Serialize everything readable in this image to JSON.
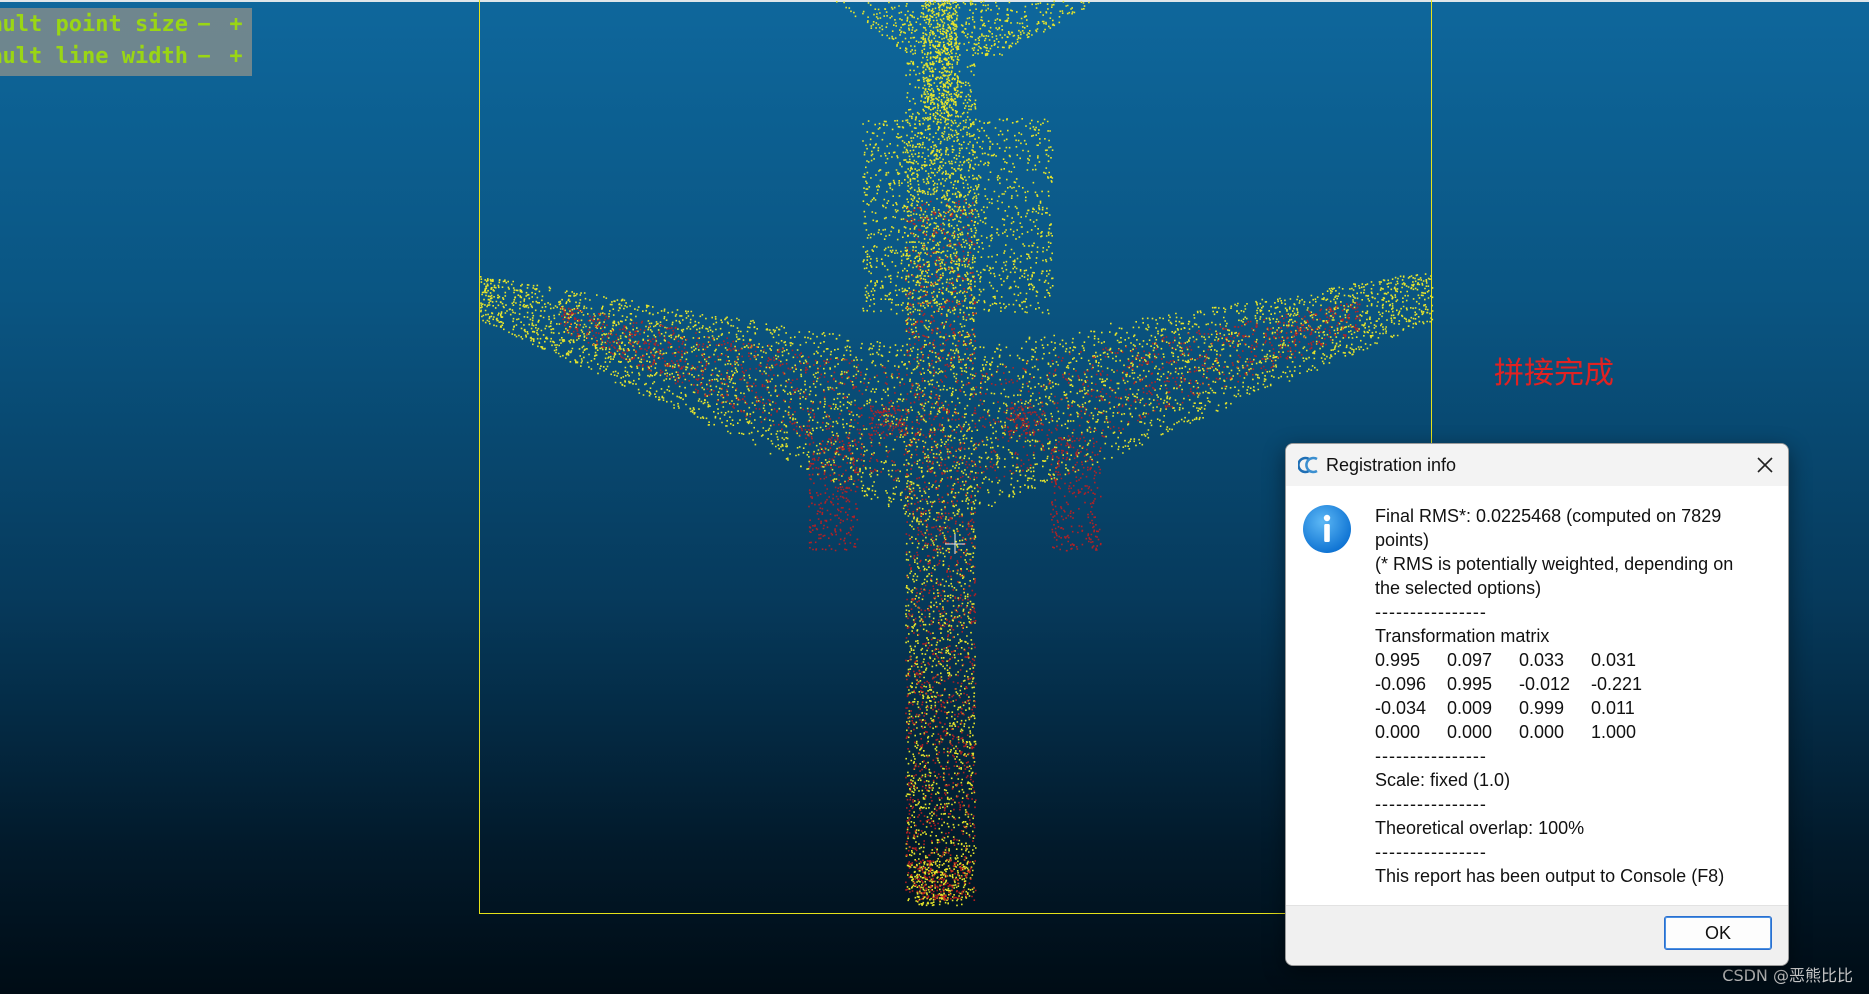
{
  "viewer": {
    "overlay": {
      "point_size_label": "Default point size",
      "line_width_label": "Default line width",
      "minus_symbol": "−",
      "plus_symbol": "+"
    },
    "caption": "拼接完成",
    "watermark": "CSDN @恶熊比比",
    "colors": {
      "background_top": "#0e679c",
      "background_bottom": "#000c15",
      "bbox": "#e6e21a",
      "cloud_source": "#e8e62a",
      "cloud_target": "#c41e1e",
      "overlay_text": "#9ad614"
    }
  },
  "dialog": {
    "title": "Registration info",
    "app_icon": "cloudcompare-icon",
    "info_icon": "info-icon",
    "close_icon": "close-icon",
    "rms_line_1": "Final RMS*: 0.0225468 (computed on 7829",
    "rms_line_2": "points)",
    "rms_note_1": "(* RMS is potentially weighted, depending on",
    "rms_note_2": "the selected options)",
    "separator": "----------------",
    "matrix_title": "Transformation matrix",
    "matrix": [
      [
        "0.995",
        "0.097",
        "0.033",
        "0.031"
      ],
      [
        "-0.096",
        "0.995",
        "-0.012",
        "-0.221"
      ],
      [
        "-0.034",
        "0.009",
        "0.999",
        "0.011"
      ],
      [
        "0.000",
        "0.000",
        "0.000",
        "1.000"
      ]
    ],
    "scale": "Scale: fixed (1.0)",
    "overlap": "Theoretical overlap: 100%",
    "console_note": "This report has been output to Console (F8)",
    "ok_label": "OK"
  }
}
